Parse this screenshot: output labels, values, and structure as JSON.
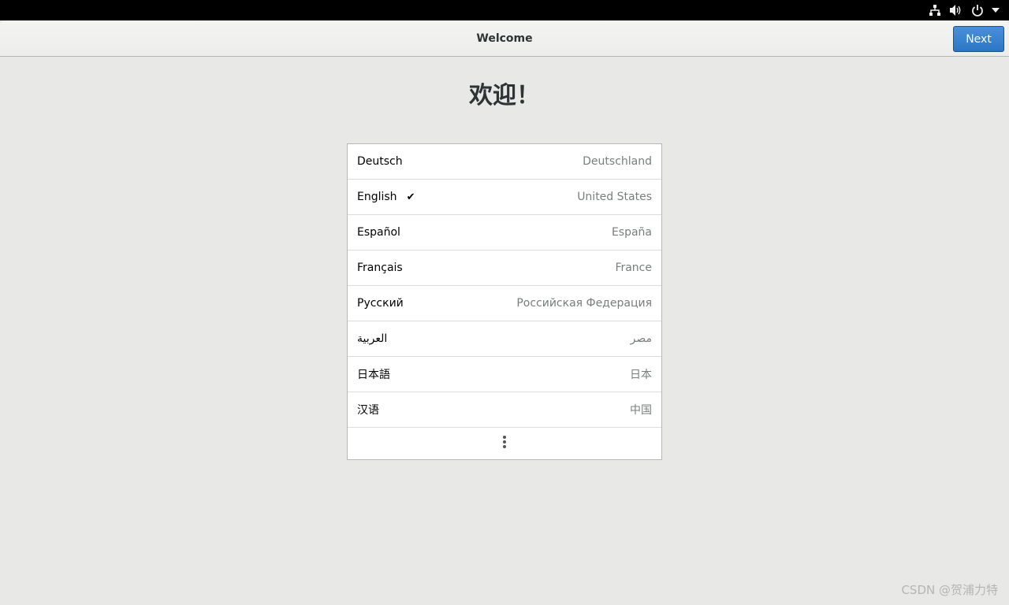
{
  "topbar": {
    "icons": [
      "network-icon",
      "volume-icon",
      "power-icon",
      "dropdown-arrow-icon"
    ]
  },
  "header": {
    "title": "Welcome",
    "next_label": "Next"
  },
  "main": {
    "heading": "欢迎！"
  },
  "languages": [
    {
      "name": "Deutsch",
      "region": "Deutschland",
      "selected": false
    },
    {
      "name": "English",
      "region": "United States",
      "selected": true
    },
    {
      "name": "Español",
      "region": "España",
      "selected": false
    },
    {
      "name": "Français",
      "region": "France",
      "selected": false
    },
    {
      "name": "Русский",
      "region": "Российская Федерация",
      "selected": false
    },
    {
      "name": "العربية",
      "region": "مصر",
      "selected": false
    },
    {
      "name": "日本語",
      "region": "日本",
      "selected": false
    },
    {
      "name": "汉语",
      "region": "中国",
      "selected": false
    }
  ],
  "selected_mark": "✔",
  "more_icon": "more-vertical-icon",
  "watermark": "CSDN @贺浦力特",
  "colors": {
    "accent": "#2a76c6",
    "background": "#e8e8e7",
    "topbar": "#000000"
  }
}
